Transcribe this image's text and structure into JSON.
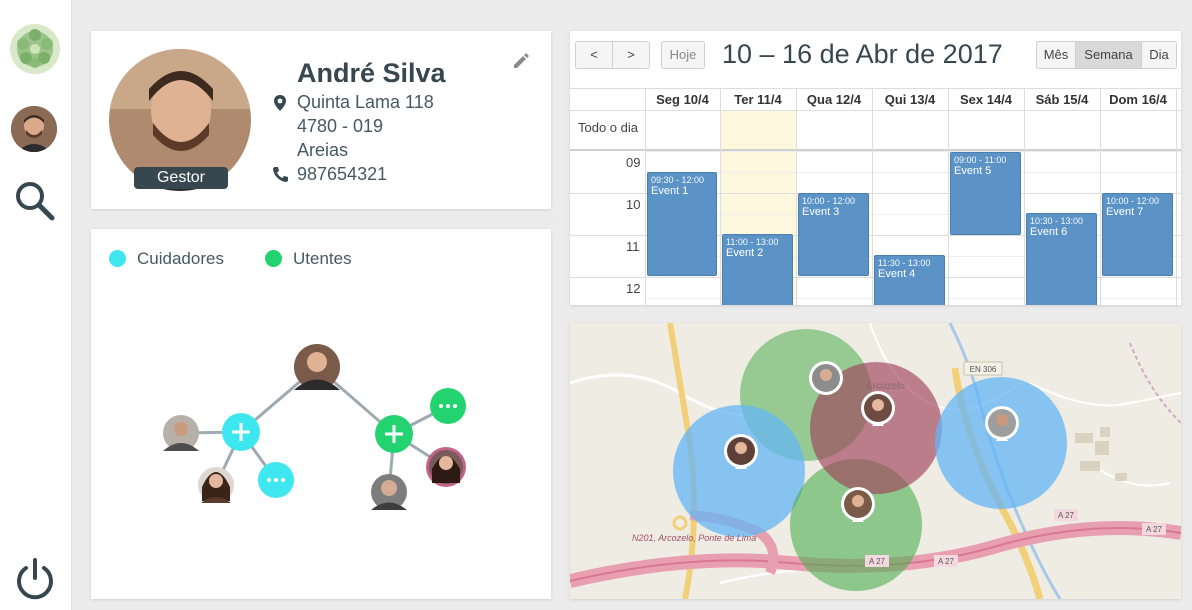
{
  "sidebar": {
    "logo": "app-logo",
    "avatar": "user-avatar",
    "search_icon": "search-icon",
    "power_icon": "power-icon"
  },
  "profile": {
    "name": "André Silva",
    "role": "Gestor",
    "address_line1": "Quinta Lama 118",
    "address_line2": "4780 - 019",
    "address_line3": "Areias",
    "phone": "987654321"
  },
  "network": {
    "legend": [
      {
        "label": "Cuidadores",
        "color": "#3ee6f0"
      },
      {
        "label": "Utentes",
        "color": "#22d36f"
      }
    ]
  },
  "calendar": {
    "title": "10 – 16 de Abr de 2017",
    "today_label": "Hoje",
    "prev_label": "<",
    "next_label": ">",
    "views": [
      "Mês",
      "Semana",
      "Dia"
    ],
    "active_view": "Semana",
    "allday_label": "Todo o dia",
    "days": [
      "Seg 10/4",
      "Ter 11/4",
      "Qua 12/4",
      "Qui 13/4",
      "Sex 14/4",
      "Sáb 15/4",
      "Dom 16/4"
    ],
    "hours": [
      "09",
      "10",
      "11",
      "12"
    ],
    "events": [
      {
        "time": "09:30 - 12:00",
        "title": "Event 1"
      },
      {
        "time": "11:00 - 13:00",
        "title": "Event 2"
      },
      {
        "time": "10:00 - 12:00",
        "title": "Event 3"
      },
      {
        "time": "11:30 - 13:00",
        "title": "Event 4"
      },
      {
        "time": "09:00 - 11:00",
        "title": "Event 5"
      },
      {
        "time": "10:30 - 13:00",
        "title": "Event 6"
      },
      {
        "time": "10:00 - 12:00",
        "title": "Event 7"
      }
    ]
  },
  "map": {
    "labels": {
      "road_en306": "EN 306",
      "road_n201": "N201, Arcozelo, Ponte de Lima",
      "road_a27_1": "A 27",
      "road_a27_2": "A 27",
      "road_a27_3": "A 27",
      "road_a27_4": "A 27",
      "town": "Arcozelo"
    },
    "colors": {
      "blue_zone": "#64b5f6",
      "green_zone": "#4caf50",
      "red_zone": "#a0425a"
    }
  }
}
